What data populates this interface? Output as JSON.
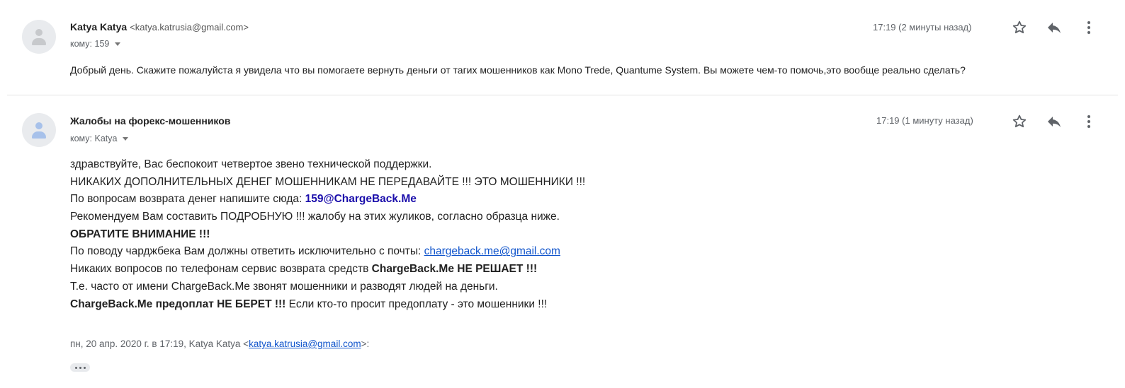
{
  "message1": {
    "sender_name": "Katya Katya",
    "sender_email": "<katya.katrusia@gmail.com>",
    "to": "кому: 159",
    "time": "17:19 (2 минуты назад)",
    "snippet": "Добрый день. Скажите пожалуйста я увидела что вы помогаете вернуть деньги от тагих мошенников как Mono Trede, Quantume System. Вы можете чем-то помочь,это вообще реально сделать?"
  },
  "message2": {
    "sender_name": "Жалобы на форекс-мошенников",
    "to": "кому: Katya",
    "time": "17:19 (1 минуту назад)",
    "body": {
      "l1": "здравствуйте, Вас беспокоит четвертое звено технической поддержки.",
      "l2": "НИКАКИХ ДОПОЛНИТЕЛЬНЫХ ДЕНЕГ МОШЕННИКАМ НЕ ПЕРЕДАВАЙТЕ !!! ЭТО МОШЕННИКИ !!!",
      "l3_text": "По вопросам возврата денег напишите сюда: ",
      "l3_email": "159@ChargeBack.Me",
      "l4": "Рекомендуем Вам составить ПОДРОБНУЮ !!! жалобу на этих жуликов, согласно образца ниже.",
      "l5": "ОБРАТИТЕ ВНИМАНИЕ !!!",
      "l6_text": "По поводу чарджбека Вам должны ответить исключительно с почты: ",
      "l6_link": "chargeback.me@gmail.com",
      "l7_text": "Никаких вопросов по телефонам сервис возврата средств ",
      "l7_bold": "ChargeBack.Me НЕ РЕШАЕТ !!!",
      "l8": "Т.е. часто от имени ChargeBack.Me звонят мошенники и разводят людей на деньги.",
      "l9_bold": "ChargeBack.Me предоплат НЕ БЕРЕТ !!!",
      "l9_text": " Если кто-то просит предоплату - это мошенники !!!"
    },
    "quote": {
      "prefix": "пн, 20 апр. 2020 г. в 17:19, Katya Katya <",
      "email": "katya.katrusia@gmail.com",
      "suffix": ">:"
    }
  },
  "icons": {
    "star": "star-icon",
    "reply": "reply-icon",
    "more": "more-vert-icon"
  }
}
